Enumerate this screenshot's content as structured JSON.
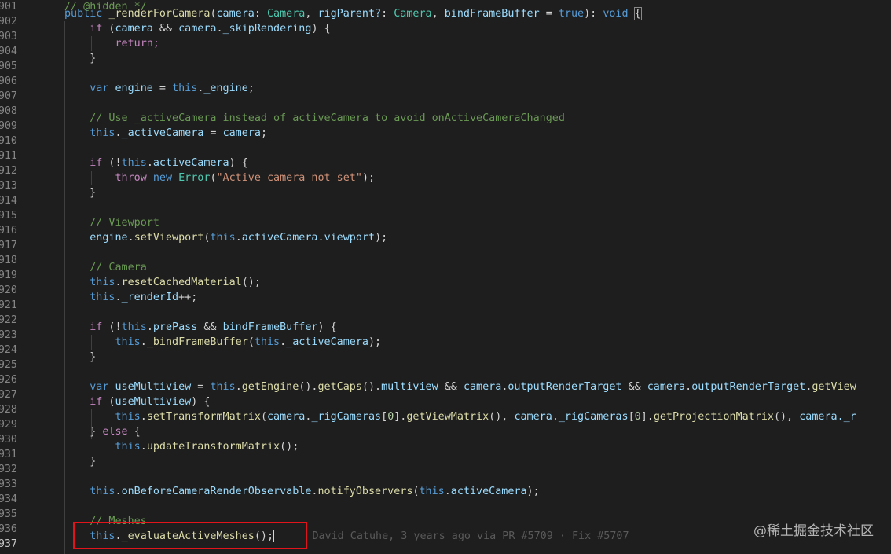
{
  "editor": {
    "line_numbers": [
      "901",
      "902",
      "903",
      "904",
      "905",
      "906",
      "907",
      "908",
      "909",
      "910",
      "911",
      "912",
      "913",
      "914",
      "915",
      "916",
      "917",
      "918",
      "919",
      "920",
      "921",
      "922",
      "923",
      "924",
      "925",
      "926",
      "927",
      "928",
      "929",
      "930",
      "931",
      "932",
      "933",
      "934",
      "935",
      "936",
      "937"
    ],
    "active_line": "937"
  },
  "code": {
    "l901": "// @hidden */",
    "l902": {
      "kw_public": "public",
      "fn": "_renderForCamera",
      "p1": "camera",
      "t1": "Camera",
      "p2": "rigParent?",
      "t2": "Camera",
      "p3": "bindFrameBuffer",
      "val": "true",
      "ret": "void"
    },
    "l903": {
      "kw": "if",
      "a": "camera",
      "b": "camera",
      "prop": "_skipRendering"
    },
    "l904": "return;",
    "l905": "}",
    "l907": {
      "kw": "var",
      "name": "engine",
      "this": "this",
      "prop": "_engine"
    },
    "l909": "// Use _activeCamera instead of activeCamera to avoid onActiveCameraChanged",
    "l910": {
      "this": "this",
      "prop": "_activeCamera",
      "val": "camera"
    },
    "l912": {
      "kw": "if",
      "this": "this",
      "prop": "activeCamera"
    },
    "l913": {
      "kw": "throw",
      "new": "new",
      "type": "Error",
      "str": "\"Active camera not set\""
    },
    "l914": "}",
    "l916": "// Viewport",
    "l917": {
      "obj": "engine",
      "fn": "setViewport",
      "this": "this",
      "p1": "activeCamera",
      "p2": "viewport"
    },
    "l919": "// Camera",
    "l920": {
      "this": "this",
      "fn": "resetCachedMaterial"
    },
    "l921": {
      "this": "this",
      "prop": "_renderId"
    },
    "l923": {
      "kw": "if",
      "this": "this",
      "prop": "prePass",
      "b": "bindFrameBuffer"
    },
    "l924": {
      "this": "this",
      "fn": "_bindFrameBuffer",
      "this2": "this",
      "prop": "_activeCamera"
    },
    "l925": "}",
    "l927": {
      "kw": "var",
      "name": "useMultiview",
      "this": "this",
      "fn1": "getEngine",
      "fn2": "getCaps",
      "p": "multiview",
      "c1": "camera",
      "p2": "outputRenderTarget",
      "c2": "camera",
      "p3": "outputRenderTarget",
      "fn3": "getView"
    },
    "l928": {
      "kw": "if",
      "v": "useMultiview"
    },
    "l929": {
      "this": "this",
      "fn": "setTransformMatrix",
      "c": "camera",
      "p": "_rigCameras",
      "i": "0",
      "fn2": "getViewMatrix",
      "c2": "camera",
      "p2": "_rigCameras",
      "i2": "0",
      "fn3": "getProjectionMatrix",
      "c3": "camera",
      "tail": "._r"
    },
    "l930": {
      "kw": "else"
    },
    "l931": {
      "this": "this",
      "fn": "updateTransformMatrix"
    },
    "l932": "}",
    "l934": {
      "this": "this",
      "p": "onBeforeCameraRenderObservable",
      "fn": "notifyObservers",
      "this2": "this",
      "p2": "activeCamera"
    },
    "l936": "// Meshes",
    "l937": {
      "this": "this",
      "fn": "_evaluateActiveMeshes"
    }
  },
  "blame": "David Catuhe, 3 years ago via PR #5709 · Fix #5707",
  "watermark": "@稀土掘金技术社区"
}
